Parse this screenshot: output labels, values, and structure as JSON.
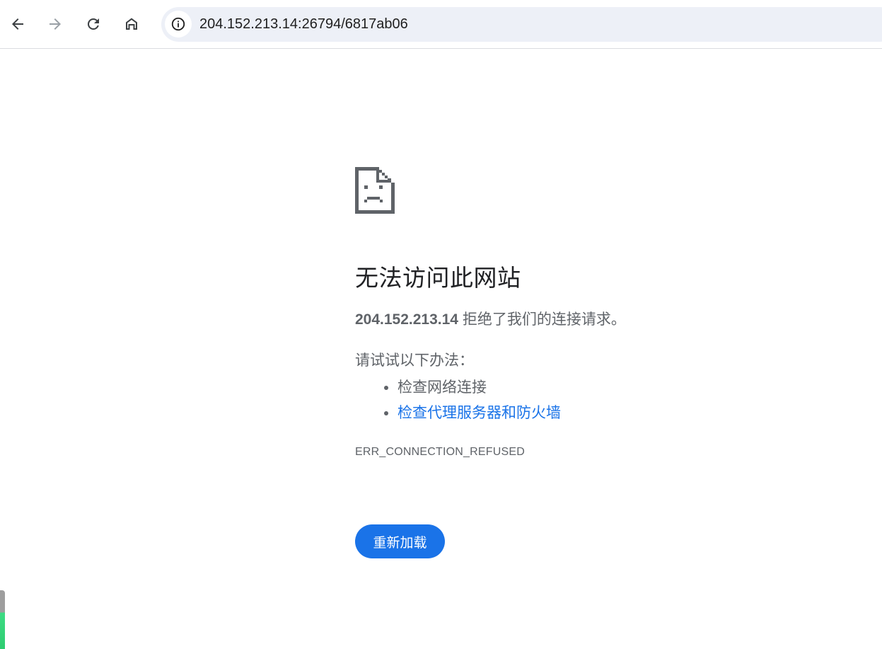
{
  "browser": {
    "url": "204.152.213.14:26794/6817ab06",
    "icons": {
      "back": "arrow-left",
      "forward": "arrow-right",
      "reload": "refresh",
      "home": "home",
      "site_info": "info-circle"
    }
  },
  "error_page": {
    "icon": "sad-document-icon",
    "title": "无法访问此网站",
    "host": "204.152.213.14",
    "summary_rest": " 拒绝了我们的连接请求。",
    "suggestions_title": "请试试以下办法：",
    "suggestions": [
      {
        "text": "检查网络连接",
        "is_link": false
      },
      {
        "text": "检查代理服务器和防火墙",
        "is_link": true
      }
    ],
    "error_code": "ERR_CONNECTION_REFUSED",
    "reload_label": "重新加载"
  },
  "colors": {
    "link": "#1a73e8",
    "button_bg": "#1a73e8",
    "text": "#5f6368",
    "heading": "#202124",
    "omnibox_bg": "#edf0f7"
  }
}
